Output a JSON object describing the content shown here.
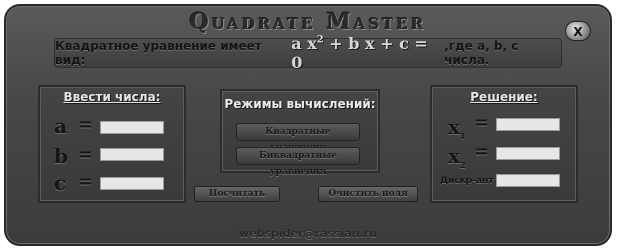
{
  "window": {
    "title": "Quadrate Master",
    "close_label": "X"
  },
  "formula": {
    "prefix": "Квадратное уравнение имеет вид:",
    "equation_a": "a",
    "equation_x1": "x",
    "equation_pow": "2",
    "equation_rest": "+ b x + c = 0",
    "suffix": ",где a, b, с числа."
  },
  "input_panel": {
    "title": "Ввести числа:",
    "labels": [
      "a",
      "b",
      "c"
    ],
    "eq": "=",
    "values": [
      "",
      "",
      ""
    ]
  },
  "modes_panel": {
    "title": "Режимы вычислений:",
    "buttons": [
      "Квадратные уравнения",
      "Биквадратные уравнения"
    ]
  },
  "actions": {
    "compute": "Посчитать",
    "clear": "Очистить поля"
  },
  "solution_panel": {
    "title": "Решение:",
    "x_label": "x",
    "x1_sub": "1",
    "x2_sub": "2",
    "eq": "=",
    "discriminant_label": "Дискр-ант",
    "values": {
      "x1": "",
      "x2": "",
      "discriminant": ""
    }
  },
  "footer": {
    "email": "webspider@rassian.ru"
  }
}
